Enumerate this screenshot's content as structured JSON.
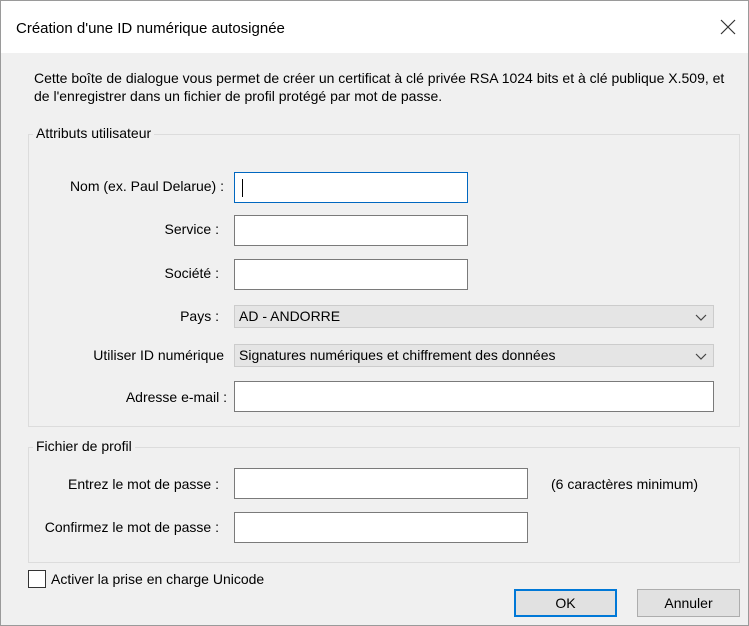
{
  "window": {
    "title": "Création d'une ID numérique autosignée",
    "close_icon": "close-icon"
  },
  "description": "Cette boîte de dialogue vous permet de créer un certificat à clé privée RSA 1024 bits et à clé publique X.509, et de l'enregistrer dans un fichier de profil protégé par mot de passe.",
  "user_attributes": {
    "legend": "Attributs utilisateur",
    "name_label": "Nom (ex. Paul Delarue) :",
    "name_value": "",
    "service_label": "Service :",
    "service_value": "",
    "company_label": "Société :",
    "company_value": "",
    "country_label": "Pays :",
    "country_value": "AD - ANDORRE",
    "use_label": "Utiliser ID numérique",
    "use_value": "Signatures numériques et chiffrement des données",
    "email_label": "Adresse e-mail :",
    "email_value": ""
  },
  "profile_file": {
    "legend": "Fichier de profil",
    "password_label": "Entrez le mot de passe :",
    "password_value": "",
    "password_hint": "(6 caractères minimum)",
    "confirm_label": "Confirmez le mot de passe :",
    "confirm_value": ""
  },
  "unicode": {
    "label": "Activer la prise en charge Unicode",
    "checked": false
  },
  "buttons": {
    "ok": "OK",
    "cancel": "Annuler"
  },
  "colors": {
    "dialog_bg": "#f0f0f0",
    "titlebar_bg": "#ffffff",
    "focus_border": "#0067c0",
    "default_button_border": "#0078d7"
  }
}
